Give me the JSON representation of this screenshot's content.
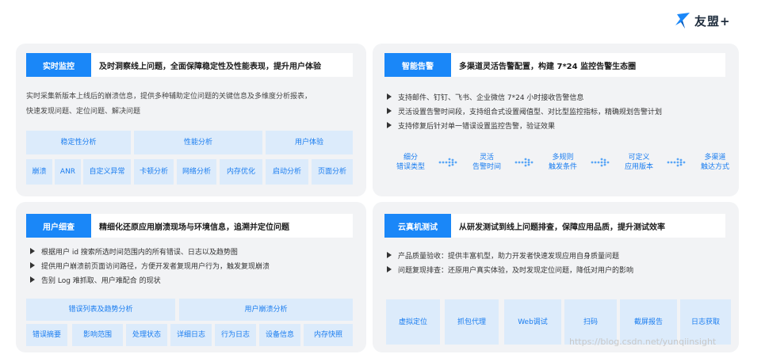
{
  "brand": {
    "name": "友盟+"
  },
  "panels": {
    "realtime": {
      "tag": "实时监控",
      "title": "及时洞察线上问题，全面保障稳定性及性能表现，提升用户体验",
      "desc_line1": "实时采集新版本上线后的崩溃信息，提供多种辅助定位问题的关键信息及多维度分析报表，",
      "desc_line2": "快速发现问题、定位问题、解决问题",
      "groups": [
        "稳定性分析",
        "性能分析",
        "用户体验"
      ],
      "items": [
        "崩溃",
        "ANR",
        "自定义异常",
        "卡顿分析",
        "网络分析",
        "内存优化",
        "启动分析",
        "页面分析"
      ]
    },
    "alert": {
      "tag": "智能告警",
      "title": "多渠道灵活告警配置，构建 7*24 监控告警生态圈",
      "bullets": [
        "支持邮件、钉钉、飞书、企业微信 7*24 小时接收告警信息",
        "灵活设置告警时间段，支持组合式设置阈值型、对比型监控指标，精确规划告警计划",
        "支持修复后针对单一错误设置监控告警，验证效果"
      ],
      "flow": [
        [
          "细分",
          "错误类型"
        ],
        [
          "灵活",
          "告警时间"
        ],
        [
          "多规则",
          "触发条件"
        ],
        [
          "可定义",
          "应用版本"
        ],
        [
          "多渠道",
          "触达方式"
        ]
      ]
    },
    "user": {
      "tag": "用户细查",
      "title": "精细化还原应用崩溃现场与环境信息，追溯并定位问题",
      "bullets": [
        "根据用户 id 搜索所选时间范围内的所有错误、日志以及趋势图",
        "提供用户崩溃前页面访问路径，方便开发者复现用户行为，触发复现崩溃",
        "告别 Log 难抓取、用户难配合 的现状"
      ],
      "groups": [
        "错误列表及趋势分析",
        "用户崩溃分析"
      ],
      "items": [
        "错误摘要",
        "影响范围",
        "处理状态",
        "详细日志",
        "行为日志",
        "设备信息",
        "内存快照"
      ]
    },
    "cloud": {
      "tag": "云真机测试",
      "title": "从研发测试到线上问题排查，保障应用品质，提升测试效率",
      "bullets": [
        "产品质量验收：提供丰富机型，助力开发者快速发现应用自身质量问题",
        "问题复现排查：还原用户真实体验，及时发现定位问题，降低对用户的影响"
      ],
      "items": [
        "虚拟定位",
        "抓包代理",
        "Web调试",
        "扫码",
        "截屏报告",
        "日志获取"
      ]
    }
  },
  "watermark": "https://blog.csdn.net/yunqiinsight"
}
